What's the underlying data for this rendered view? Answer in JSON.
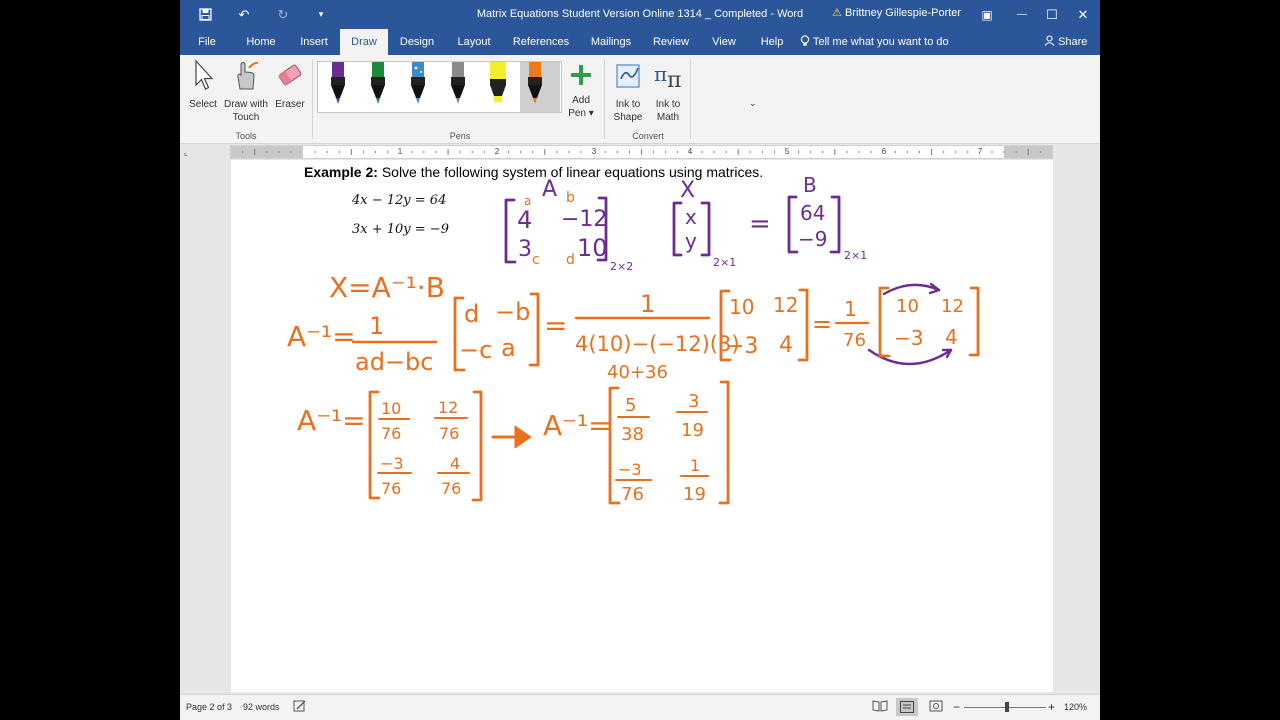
{
  "titlebar": {
    "doc_title": "Matrix Equations Student Version Online 1314 _ Completed  -  Word",
    "user": "Brittney Gillespie-Porter",
    "warning_glyph": "⚠",
    "save_glyph": "💾",
    "undo_glyph": "↶",
    "redo_glyph": "↻",
    "customize_glyph": "▾",
    "ribbon_display_glyph": "▣",
    "minimize_glyph": "—",
    "maximize_glyph": "☐",
    "close_glyph": "✕"
  },
  "tabs": [
    {
      "label": "File"
    },
    {
      "label": "Home"
    },
    {
      "label": "Insert"
    },
    {
      "label": "Draw"
    },
    {
      "label": "Design"
    },
    {
      "label": "Layout"
    },
    {
      "label": "References"
    },
    {
      "label": "Mailings"
    },
    {
      "label": "Review"
    },
    {
      "label": "View"
    },
    {
      "label": "Help"
    }
  ],
  "tell_me": "Tell me what you want to do",
  "share": "Share",
  "ribbon": {
    "select": "Select",
    "draw_touch_1": "Draw with",
    "draw_touch_2": "Touch",
    "eraser": "Eraser",
    "tools_group": "Tools",
    "pens_group": "Pens",
    "add_pen_1": "Add",
    "add_pen_2": "Pen ▾",
    "ink_shape_1": "Ink to",
    "ink_shape_2": "Shape",
    "ink_math_1": "Ink to",
    "ink_math_2": "Math",
    "convert_group": "Convert",
    "gallery_more": "⌄"
  },
  "pens": [
    {
      "color": "#6a2d91"
    },
    {
      "color": "#1d8a3a"
    },
    {
      "color": "#3a8dc9"
    },
    {
      "color": "#8a8a8a"
    },
    {
      "color": "#f4ee2a"
    },
    {
      "color": "#f07a1a"
    }
  ],
  "ruler": {
    "corner": "⌞",
    "numbers": [
      "1",
      "2",
      "3",
      "4",
      "5",
      "6",
      "7"
    ]
  },
  "page": {
    "example_label": "Example 2:",
    "example_text": " Solve the following system of linear equations using matrices.",
    "eq1": "4x − 12y = 64",
    "eq2": "3x + 10y =  −9"
  },
  "ink": {
    "purple": "#6a2d91",
    "orange": "#e8701e",
    "lbl_A": "A",
    "lbl_a": "a",
    "lbl_b": "b",
    "lbl_c": "c",
    "lbl_d": "d",
    "m1_11": "4",
    "m1_12": "−12",
    "m1_21": "3",
    "m1_22": "10",
    "dim_a": "2×2",
    "lbl_X": "X",
    "x_1": "x",
    "x_2": "y",
    "dim_x": "2×1",
    "equals": "=",
    "lbl_B": "B",
    "b_1": "64",
    "b_2": "−9",
    "dim_b": "2×1",
    "x_eq": "X=A⁻¹·B",
    "ainv1": "A⁻¹=",
    "num_1": "1",
    "ad_bc": "ad−bc",
    "adj_11": "d",
    "adj_12": "−b",
    "adj_21": "−c",
    "adj_22": "a",
    "eq_sign": "=",
    "num_1b": "1",
    "denom_expr": "4(10)−(−12)(3)",
    "m3_11": "10",
    "m3_12": "12",
    "m3_21": "−3",
    "m3_22": "4",
    "eq_sign2": "=",
    "num_1c": "1",
    "den_76": "76",
    "m4_11": "10",
    "m4_12": "12",
    "m4_21": "−3",
    "m4_22": "4",
    "side_note": "40+36",
    "ainv2": "A⁻¹=",
    "f_11n": "10",
    "f_11d": "76",
    "f_12n": "12",
    "f_12d": "76",
    "f_21n": "−3",
    "f_21d": "76",
    "f_22n": "4",
    "f_22d": "76",
    "ainv3": "A⁻¹=",
    "g_11n": "5",
    "g_11d": "38",
    "g_12n": "3",
    "g_12d": "19",
    "g_21n": "−3",
    "g_21d": "76",
    "g_22n": "1",
    "g_22d": "19"
  },
  "status": {
    "page": "Page 2 of 3",
    "words": "92 words",
    "zoom": "120%",
    "zoom_level_percent": 120,
    "zoom_minus": "−",
    "zoom_plus": "+"
  }
}
